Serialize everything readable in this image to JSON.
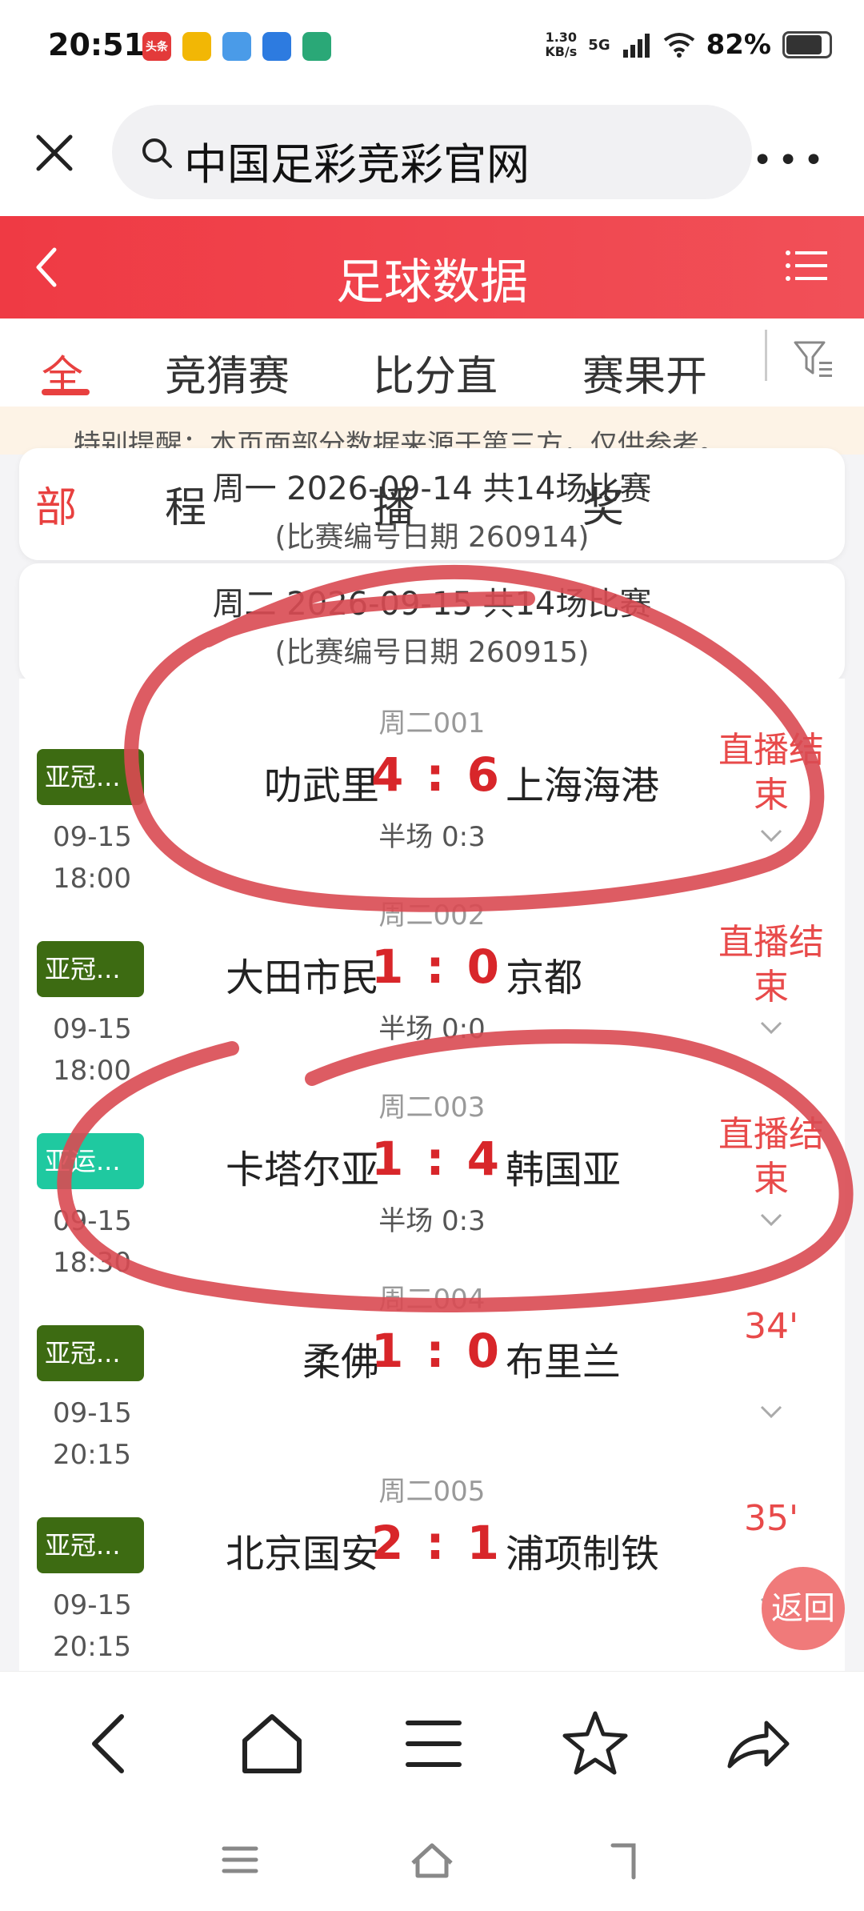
{
  "status_bar": {
    "time": "20:51",
    "app_icons": [
      {
        "name": "toutiao-icon",
        "label": "头条",
        "color": "#e33a3a"
      },
      {
        "name": "hand-app-icon",
        "label": "",
        "color": "#f2b705"
      },
      {
        "name": "map-pin-icon",
        "label": "",
        "color": "#4a9be8"
      },
      {
        "name": "browser-app-icon",
        "label": "",
        "color": "#2d7be0"
      },
      {
        "name": "bank-app-icon",
        "label": "",
        "color": "#2aa877"
      }
    ],
    "net_speed": "1.30",
    "net_unit": "KB/s",
    "network": "5G",
    "battery": "82%",
    "battery_level": 0.82
  },
  "browser": {
    "search_text": "中国足彩竞彩官网"
  },
  "page": {
    "title": "足球数据"
  },
  "tabs": [
    {
      "label": "全"
    },
    {
      "label": "竞猜赛"
    },
    {
      "label": "比分直"
    },
    {
      "label": "赛果开"
    }
  ],
  "tabs_wrap": [
    {
      "label": "部"
    },
    {
      "label": "程"
    },
    {
      "label": "播"
    },
    {
      "label": "奖"
    }
  ],
  "notice": "特别提醒：本页面部分数据来源于第三方，仅供参考。",
  "days": [
    {
      "line1": "周一 2026-09-14 共14场比赛",
      "line2": "(比赛编号日期 260914)"
    },
    {
      "line1": "周二 2026-09-15 共14场比赛",
      "line2": "(比赛编号日期 260915)"
    }
  ],
  "matches": [
    {
      "code": "周二001",
      "league": "亚冠...",
      "league_color": "#3d6b12",
      "date": "09-15",
      "time": "18:00",
      "home": "叻武里",
      "home_score": "4",
      "away_score": "6",
      "away": "上海海港",
      "half": "半场 0:3",
      "status": "直播结束"
    },
    {
      "code": "周二002",
      "league": "亚冠...",
      "league_color": "#3d6b12",
      "date": "09-15",
      "time": "18:00",
      "home": "大田市民",
      "home_score": "1",
      "away_score": "0",
      "away": "京都",
      "half": "半场 0:0",
      "status": "直播结束"
    },
    {
      "code": "周二003",
      "league": "亚运...",
      "league_color": "#1fc9a0",
      "date": "09-15",
      "time": "18:30",
      "home": "卡塔尔亚",
      "home_score": "1",
      "away_score": "4",
      "away": "韩国亚",
      "half": "半场 0:3",
      "status": "直播结束"
    },
    {
      "code": "周二004",
      "league": "亚冠...",
      "league_color": "#3d6b12",
      "date": "09-15",
      "time": "20:15",
      "home": "柔佛",
      "home_score": "1",
      "away_score": "0",
      "away": "布里兰",
      "half": "",
      "status": "34'"
    },
    {
      "code": "周二005",
      "league": "亚冠...",
      "league_color": "#3d6b12",
      "date": "09-15",
      "time": "20:15",
      "home": "北京国安",
      "home_score": "2",
      "away_score": "1",
      "away": "浦项制铁",
      "half": "",
      "status": "35'"
    }
  ],
  "float_back": "返回",
  "colors": {
    "accent": "#e8403f",
    "score": "#d8262a",
    "scribble": "#d94a52"
  }
}
